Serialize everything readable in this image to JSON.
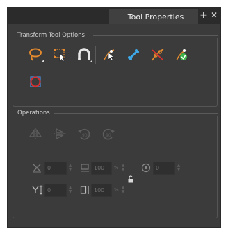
{
  "window": {
    "tab_title": "Tool Properties",
    "add_label": "+",
    "close_label": "✕"
  },
  "transform_options": {
    "title": "Transform Tool Options",
    "tools": [
      {
        "name": "lasso-select",
        "icon": "lasso-icon",
        "has_menu": true
      },
      {
        "name": "bounding-box-select",
        "icon": "bounding-box-icon",
        "has_menu": false
      },
      {
        "name": "snap-magnet",
        "icon": "magnet-icon",
        "has_menu": true
      },
      {
        "name": "peg-selection-mode",
        "icon": "select-peg-icon",
        "has_menu": false
      },
      {
        "name": "bone-mode",
        "icon": "bone-icon",
        "has_menu": false
      },
      {
        "name": "hide-manipulator-controls",
        "icon": "hide-controls-icon",
        "has_menu": false
      },
      {
        "name": "flip-mode",
        "icon": "flip-mode-icon",
        "has_menu": false
      },
      {
        "name": "no-selection",
        "icon": "no-selection-icon",
        "has_menu": false
      }
    ]
  },
  "operations": {
    "title": "Operations",
    "buttons": [
      {
        "name": "flip-horizontal",
        "icon": "flip-horizontal-icon"
      },
      {
        "name": "flip-vertical",
        "icon": "flip-vertical-icon"
      },
      {
        "name": "rotate-ccw-90",
        "icon": "rotate-ccw-icon"
      },
      {
        "name": "rotate-cw-90",
        "icon": "rotate-cw-icon"
      }
    ],
    "fields": {
      "x": {
        "value": "0",
        "icon": "x-position-icon"
      },
      "y": {
        "value": "0",
        "icon": "y-position-icon"
      },
      "width": {
        "value": "100",
        "unit": "%",
        "icon": "width-icon"
      },
      "height": {
        "value": "100",
        "unit": "%",
        "icon": "height-icon"
      },
      "angle": {
        "value": "0",
        "icon": "angle-icon"
      }
    },
    "lock_icon": "lock-icon"
  },
  "colors": {
    "panel_bg": "#3b3b3b",
    "tab_bg": "#404040",
    "accent_orange": "#e58a2e",
    "accent_blue": "#3fa9e8",
    "accent_red": "#d83030",
    "accent_green": "#3fb54a"
  }
}
